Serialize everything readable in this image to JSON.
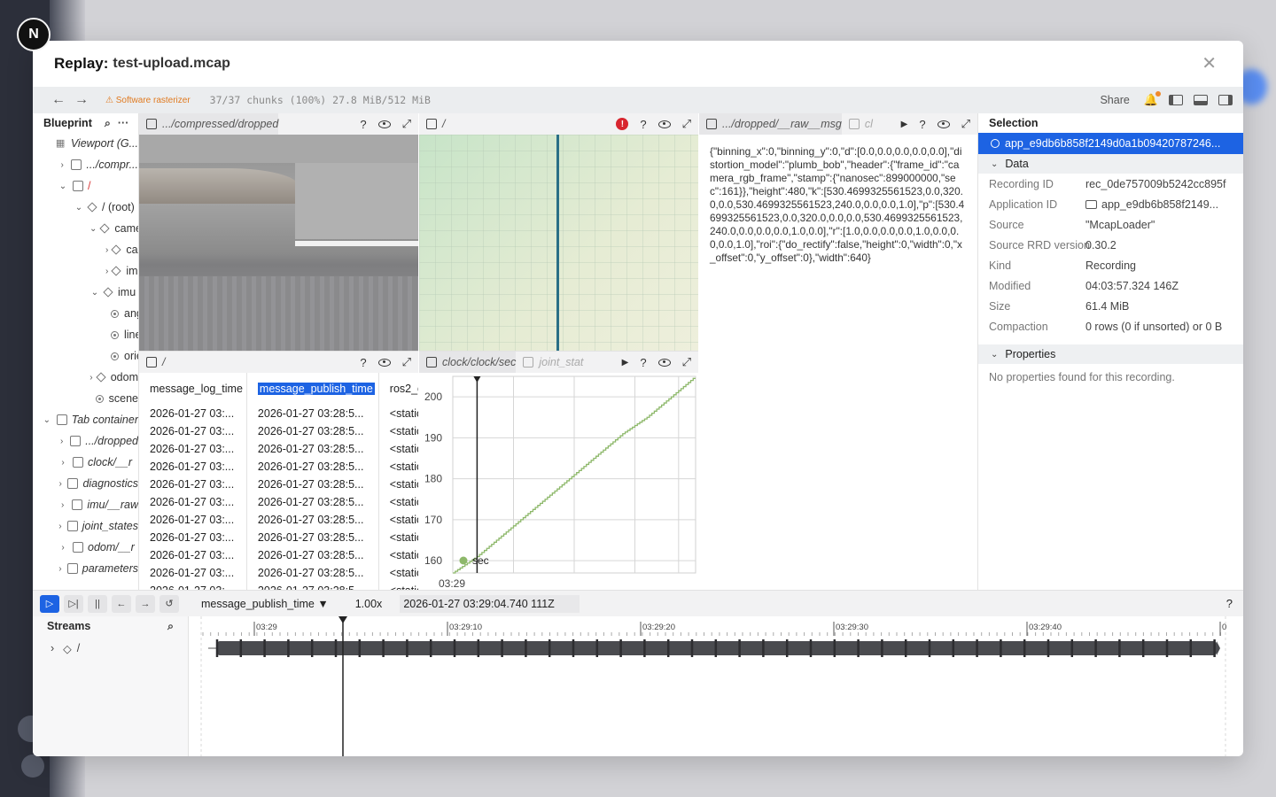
{
  "app_badge": "N",
  "modal": {
    "title": "Replay:",
    "file": "test-upload.mcap"
  },
  "topbar": {
    "warning": "⚠ Software rasterizer",
    "chunks": "37/37 chunks (100%) 27.8 MiB/512 MiB",
    "share": "Share"
  },
  "blueprint": {
    "title": "Blueprint",
    "items": [
      {
        "label": "Viewport (G...",
        "italic": true,
        "indent": 0,
        "chev": "",
        "icon": "grid"
      },
      {
        "label": ".../compr...",
        "italic": true,
        "indent": 1,
        "chev": "›",
        "icon": "box"
      },
      {
        "label": "/",
        "italic": false,
        "red": true,
        "indent": 1,
        "chev": "⌄",
        "icon": "box"
      },
      {
        "label": "/ (root)",
        "indent": 2,
        "chev": "⌄",
        "icon": "dia"
      },
      {
        "label": "camera",
        "indent": 3,
        "chev": "⌄",
        "icon": "dia"
      },
      {
        "label": "camera_info",
        "indent": 4,
        "chev": "›",
        "icon": "dia"
      },
      {
        "label": "image",
        "indent": 4,
        "chev": "›",
        "icon": "dia"
      },
      {
        "label": "imu",
        "indent": 3,
        "chev": "⌄",
        "icon": "dia"
      },
      {
        "label": "angular",
        "indent": 4,
        "chev": "",
        "icon": "dot"
      },
      {
        "label": "linear",
        "indent": 4,
        "chev": "",
        "icon": "dot"
      },
      {
        "label": "orientation",
        "indent": 4,
        "chev": "",
        "icon": "dot"
      },
      {
        "label": "odom",
        "indent": 3,
        "chev": "›",
        "icon": "dia"
      },
      {
        "label": "scene",
        "indent": 3,
        "chev": "",
        "icon": "dot"
      },
      {
        "label": "Tab container",
        "italic": true,
        "indent": 0,
        "chev": "⌄",
        "icon": "box"
      },
      {
        "label": ".../dropped",
        "italic": true,
        "indent": 1,
        "chev": "›",
        "icon": "box"
      },
      {
        "label": "clock/__r",
        "italic": true,
        "indent": 1,
        "chev": "›",
        "icon": "box"
      },
      {
        "label": "diagnostics",
        "italic": true,
        "indent": 1,
        "chev": "›",
        "icon": "box"
      },
      {
        "label": "imu/__raw",
        "italic": true,
        "indent": 1,
        "chev": "›",
        "icon": "box"
      },
      {
        "label": "joint_states",
        "italic": true,
        "indent": 1,
        "chev": "›",
        "icon": "box"
      },
      {
        "label": "odom/__r",
        "italic": true,
        "indent": 1,
        "chev": "›",
        "icon": "box"
      },
      {
        "label": "parameters",
        "italic": true,
        "indent": 1,
        "chev": "›",
        "icon": "box"
      }
    ]
  },
  "views": {
    "camera_title": ".../compressed/dropped",
    "spatial_title": "/",
    "text_tab1": ".../dropped/__raw__msg",
    "text_tab2": "cl",
    "table_title": "/",
    "plot_tab1": "clock/clock/sec",
    "plot_tab2": "joint_stat"
  },
  "text_doc": "{\"binning_x\":0,\"binning_y\":0,\"d\":[0.0,0.0,0.0,0.0,0.0],\"distortion_model\":\"plumb_bob\",\"header\":{\"frame_id\":\"camera_rgb_frame\",\"stamp\":{\"nanosec\":899000000,\"sec\":161}},\"height\":480,\"k\":[530.4699325561523,0.0,320.0,0.0,530.4699325561523,240.0,0.0,0.0,1.0],\"p\":[530.4699325561523,0.0,320.0,0.0,0.0,530.4699325561523,240.0,0.0,0.0,0.0,1.0,0.0],\"r\":[1.0,0.0,0.0,0.0,1.0,0.0,0.0,0.0,1.0],\"roi\":{\"do_rectify\":false,\"height\":0,\"width\":0,\"x_offset\":0,\"y_offset\":0},\"width\":640}",
  "table": {
    "columns": [
      "message_log_time",
      "message_publish_time",
      "ros2_c"
    ],
    "rows": [
      [
        "2026-01-27 03:...",
        "2026-01-27 03:28:5...",
        "<static"
      ],
      [
        "2026-01-27 03:...",
        "2026-01-27 03:28:5...",
        "<static"
      ],
      [
        "2026-01-27 03:...",
        "2026-01-27 03:28:5...",
        "<static"
      ],
      [
        "2026-01-27 03:...",
        "2026-01-27 03:28:5...",
        "<static"
      ],
      [
        "2026-01-27 03:...",
        "2026-01-27 03:28:5...",
        "<static"
      ],
      [
        "2026-01-27 03:...",
        "2026-01-27 03:28:5...",
        "<static"
      ],
      [
        "2026-01-27 03:...",
        "2026-01-27 03:28:5...",
        "<static"
      ],
      [
        "2026-01-27 03:...",
        "2026-01-27 03:28:5...",
        "<static"
      ],
      [
        "2026-01-27 03:...",
        "2026-01-27 03:28:5...",
        "<static"
      ],
      [
        "2026-01-27 03:...",
        "2026-01-27 03:28:5...",
        "<static"
      ],
      [
        "2026-01-27 03:...",
        "2026-01-27 03:28:5...",
        "<static"
      ]
    ]
  },
  "selection": {
    "title": "Selection",
    "item": "app_e9db6b858f2149d0a1b09420787246...",
    "data_title": "Data",
    "rows": [
      {
        "k": "Recording ID",
        "v": "rec_0de757009b5242cc895f"
      },
      {
        "k": "Application ID",
        "v": "app_e9db6b858f2149..."
      },
      {
        "k": "Source",
        "v": "\"McapLoader\""
      },
      {
        "k": "Source RRD version",
        "v": "0.30.2"
      },
      {
        "k": "Kind",
        "v": "Recording"
      },
      {
        "k": "Modified",
        "v": "04:03:57.324 146Z"
      },
      {
        "k": "Size",
        "v": "61.4 MiB"
      },
      {
        "k": "Compaction",
        "v": "0 rows (0 if unsorted) or 0 B"
      }
    ],
    "props_title": "Properties",
    "no_props": "No properties found for this recording."
  },
  "timeline": {
    "timeline_name": "message_publish_time",
    "speed": "1.00x",
    "current_time": "2026-01-27 03:29:04.740 111Z",
    "help": "?",
    "streams_title": "Streams",
    "root_stream": "/",
    "ticks": [
      "03:29",
      "03:29:10",
      "03:29:20",
      "03:29:30",
      "03:29:40",
      "0"
    ]
  },
  "chart_data": {
    "type": "line",
    "series": [
      {
        "name": "sec",
        "color": "#8db86a"
      }
    ],
    "x_label_shown": "03:29",
    "y_ticks": [
      160,
      170,
      180,
      190,
      200
    ],
    "ylim": [
      157,
      205
    ],
    "x": [
      0,
      0.1,
      0.2,
      0.3,
      0.4,
      0.5,
      0.6,
      0.7,
      0.8,
      0.9,
      1.0
    ],
    "values": [
      157,
      161,
      166,
      171,
      176,
      181,
      186,
      191,
      195,
      200,
      205
    ],
    "cursor_x": 0.1,
    "step": true
  }
}
